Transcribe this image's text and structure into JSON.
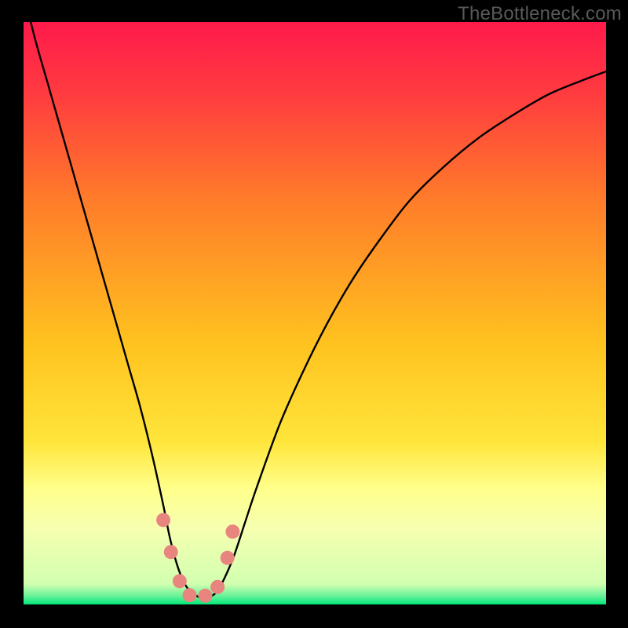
{
  "watermark": "TheBottleneck.com",
  "colors": {
    "frame": "#000000",
    "gradient_top": "#ff1a4b",
    "gradient_mid1": "#ff7a2a",
    "gradient_mid2": "#ffd21f",
    "gradient_low": "#ffff8a",
    "gradient_band": "#f6ffb0",
    "gradient_bottom": "#00e87a",
    "curve": "#000000",
    "marker": "#e9857f"
  },
  "chart_data": {
    "type": "line",
    "title": "",
    "xlabel": "",
    "ylabel": "",
    "xlim": [
      0,
      100
    ],
    "ylim": [
      0,
      100
    ],
    "series": [
      {
        "name": "bottleneck-curve",
        "x": [
          0,
          2,
          4,
          6,
          8,
          10,
          12,
          14,
          16,
          18,
          20,
          22,
          24,
          25,
          26,
          27,
          28,
          29,
          30,
          31,
          32,
          33,
          34,
          36,
          38,
          40,
          44,
          48,
          52,
          56,
          60,
          66,
          72,
          78,
          84,
          90,
          96,
          100
        ],
        "y": [
          105,
          97,
          90,
          83,
          76,
          69,
          62,
          55,
          48,
          41,
          34,
          26,
          17,
          12,
          8,
          5,
          3,
          2,
          1.3,
          1,
          1.3,
          2,
          3.5,
          8,
          14,
          20,
          31,
          40,
          48,
          55,
          61,
          69,
          75,
          80,
          84,
          87.5,
          90,
          91.5
        ]
      }
    ],
    "markers": [
      {
        "x": 24.0,
        "y": 14.5
      },
      {
        "x": 25.3,
        "y": 9.0
      },
      {
        "x": 26.8,
        "y": 4.0
      },
      {
        "x": 28.5,
        "y": 1.6
      },
      {
        "x": 31.2,
        "y": 1.5
      },
      {
        "x": 33.3,
        "y": 3.0
      },
      {
        "x": 35.0,
        "y": 8.0
      },
      {
        "x": 35.9,
        "y": 12.5
      }
    ],
    "background_gradient_stops": [
      {
        "offset": 0.0,
        "color": "#ff1a4b"
      },
      {
        "offset": 0.12,
        "color": "#ff3a40"
      },
      {
        "offset": 0.3,
        "color": "#ff7a2a"
      },
      {
        "offset": 0.55,
        "color": "#ffc21f"
      },
      {
        "offset": 0.72,
        "color": "#ffe53a"
      },
      {
        "offset": 0.8,
        "color": "#ffff8a"
      },
      {
        "offset": 0.87,
        "color": "#f6ffb0"
      },
      {
        "offset": 0.965,
        "color": "#d2ffb0"
      },
      {
        "offset": 0.985,
        "color": "#6bf29a"
      },
      {
        "offset": 1.0,
        "color": "#00e87a"
      }
    ]
  }
}
